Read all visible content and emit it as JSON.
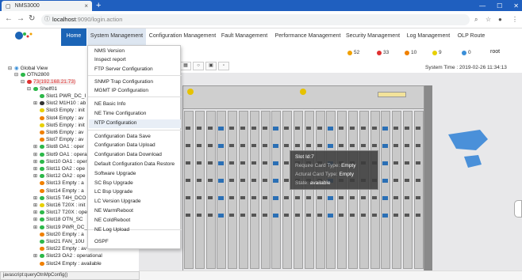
{
  "browser": {
    "tab_title": "NMS3000",
    "tab_close": "×",
    "new_tab": "+",
    "url_host": "localhost",
    "url_path": ":9090/login.action",
    "controls": [
      "—",
      "☐",
      "✕"
    ]
  },
  "nav": {
    "items": [
      {
        "label": "Home"
      },
      {
        "label": "System Management"
      },
      {
        "label": "Configuration Management"
      },
      {
        "label": "Fault Management"
      },
      {
        "label": "Performance Management"
      },
      {
        "label": "Security Management"
      },
      {
        "label": "Log Management"
      },
      {
        "label": "OLP Route"
      }
    ]
  },
  "alarms": [
    {
      "count": "52",
      "color": "#f0a000"
    },
    {
      "count": "33",
      "color": "#e03030"
    },
    {
      "count": "10",
      "color": "#f08000"
    },
    {
      "count": "9",
      "color": "#e8d000"
    },
    {
      "count": "0",
      "color": "#3a8fd8"
    }
  ],
  "user": "root",
  "system_time": "System Time :  2019-02-26 11:34:13",
  "toolbar_icons": [
    "grid-icon",
    "refresh-icon",
    "save-icon",
    "lock-icon"
  ],
  "dropdown": {
    "items": [
      "NMS Version",
      "Inspect report",
      "FTP Server Configuration",
      "SNMP Trap Configuration",
      "MGMT IP Configuration",
      "NE Basic Info",
      "NE Time Configuration",
      "NTP Configuration",
      "Configuration Data Save",
      "Configuration Data Upload",
      "Configuration Data Download",
      "Default Configuration Data Restore",
      "Software Upgrade",
      "SC Bsp Upgrade",
      "LC Bsp Upgrade",
      "LC Version Upgrade",
      "NE WarmReboot",
      "NE ColdReboot",
      "NE Log Upload",
      "OSPF"
    ]
  },
  "tree": {
    "root": "Global View",
    "otn": "OTN2800",
    "ne": "73(192.168.21.73)",
    "shelf": "Shelf01",
    "slots": [
      {
        "label": "Slot1 PWR_DC_I",
        "color": "#2db84a"
      },
      {
        "label": "Slot2 M1H10 : ab",
        "color": "#333333"
      },
      {
        "label": "Slot3 Empty : init",
        "color": "#e8d000"
      },
      {
        "label": "Slot4 Empty : av",
        "color": "#f08000"
      },
      {
        "label": "Slot5 Empty : init",
        "color": "#e8d000"
      },
      {
        "label": "Slot6 Empty : av",
        "color": "#f08000"
      },
      {
        "label": "Slot7 Empty : av",
        "color": "#f08000"
      },
      {
        "label": "Slot8 OA1 : oper",
        "color": "#2db84a"
      },
      {
        "label": "Slot9 OA1 : opera",
        "color": "#2db84a"
      },
      {
        "label": "Slot10 OA1 : oper",
        "color": "#2db84a"
      },
      {
        "label": "Slot11 OA2 : ope",
        "color": "#2db84a"
      },
      {
        "label": "Slot12 OA2 : ope",
        "color": "#2db84a"
      },
      {
        "label": "Slot13 Empty : a",
        "color": "#f08000"
      },
      {
        "label": "Slot14 Empty : a",
        "color": "#f08000"
      },
      {
        "label": "Slot15 T4H_DCO",
        "color": "#2db84a"
      },
      {
        "label": "Slot16 T20X : init",
        "color": "#e8d000"
      },
      {
        "label": "Slot17 T20X : ope",
        "color": "#2db84a"
      },
      {
        "label": "Slot18 OTN_SC",
        "color": "#2db84a"
      },
      {
        "label": "Slot19 PWR_DC_",
        "color": "#2db84a"
      },
      {
        "label": "Slot20 Empty : a",
        "color": "#f08000"
      },
      {
        "label": "Slot21 FAN_10U",
        "color": "#2db84a"
      },
      {
        "label": "Slot22 Empty : av",
        "color": "#f08000"
      },
      {
        "label": "Slot23 OA2 : operational",
        "color": "#2db84a"
      },
      {
        "label": "Slot24 Empty : available",
        "color": "#f08000"
      }
    ]
  },
  "tooltip": {
    "slot": "Slot Id:7",
    "require_key": "Require Card Type:",
    "require_val": "Empty",
    "actual_key": "Actural Card Type:",
    "actual_val": "Empty",
    "state_key": "State:",
    "state_val": "available"
  },
  "statusbar": "javascript:queryOtnMpConfig()"
}
